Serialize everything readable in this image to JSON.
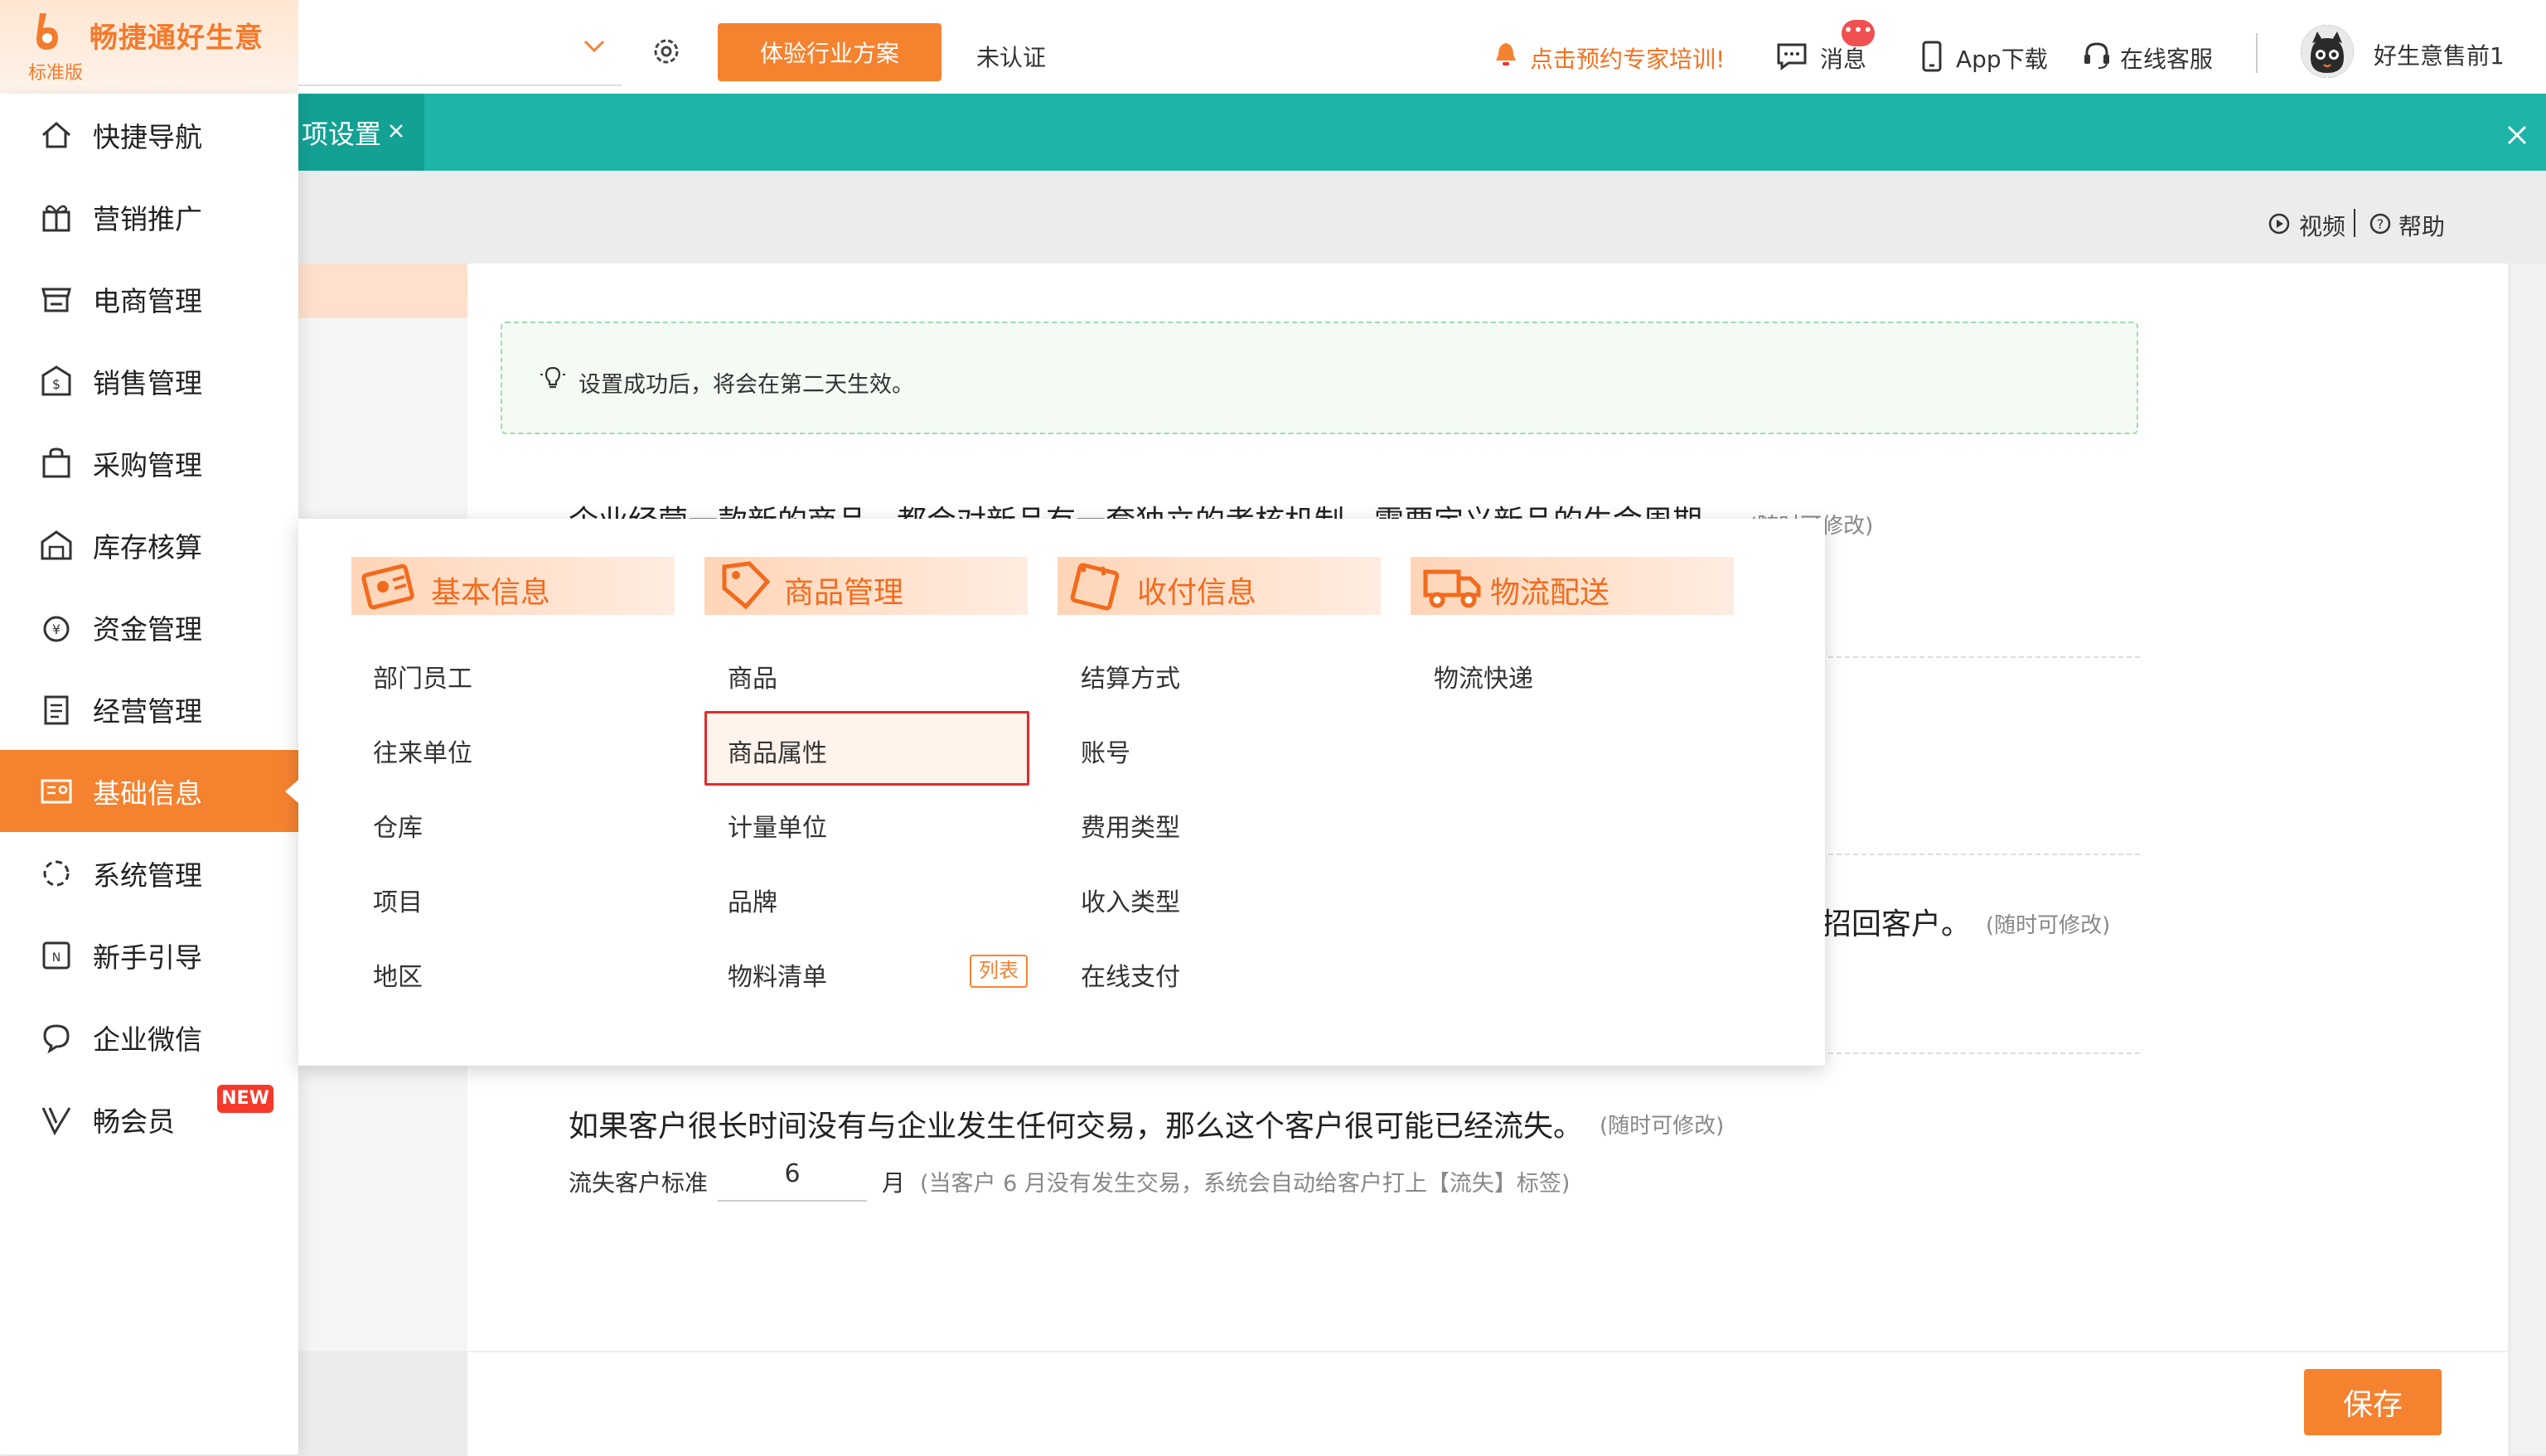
{
  "brand": {
    "title": "畅捷通好生意",
    "edition": "标准版",
    "accent": "#f5822f"
  },
  "header": {
    "trial_button": "体验行业方案",
    "certification": "未认证",
    "training_link": "点击预约专家培训!",
    "message_label": "消息",
    "message_badge": "•••",
    "app_label": "App下载",
    "support_label": "在线客服",
    "user_name": "好生意售前1"
  },
  "tabs": {
    "active_label": "项设置"
  },
  "sidebar": {
    "items": [
      {
        "label": "快捷导航",
        "icon": "home-icon"
      },
      {
        "label": "营销推广",
        "icon": "gift-icon"
      },
      {
        "label": "电商管理",
        "icon": "store-icon"
      },
      {
        "label": "销售管理",
        "icon": "sales-icon"
      },
      {
        "label": "采购管理",
        "icon": "bag-icon"
      },
      {
        "label": "库存核算",
        "icon": "warehouse-icon"
      },
      {
        "label": "资金管理",
        "icon": "money-icon"
      },
      {
        "label": "经营管理",
        "icon": "clipboard-icon"
      },
      {
        "label": "基础信息",
        "icon": "id-card-icon",
        "active": true
      },
      {
        "label": "系统管理",
        "icon": "system-icon"
      },
      {
        "label": "新手引导",
        "icon": "guide-icon"
      },
      {
        "label": "企业微信",
        "icon": "wecom-icon"
      },
      {
        "label": "畅会员",
        "icon": "vip-icon"
      }
    ],
    "new_badge": "NEW"
  },
  "help": {
    "video": "视频",
    "help": "帮助"
  },
  "main": {
    "notice": "设置成功后，将会在第二天生效。",
    "para1": "企业经营一款新的商品，都会对新品有一套独立的考核机制，需要定义新品的生命周期。",
    "para1_hint": "(随时可修改)",
    "para2_tail": "招回客户。",
    "para2_hint": "(随时可修改)",
    "para3": "如果客户很长时间没有与企业发生任何交易，那么这个客户很可能已经流失。",
    "para3_hint": "(随时可修改)",
    "lost_label": "流失客户标准",
    "lost_value": "6",
    "lost_unit": "月",
    "lost_hint": "(当客户 6 月没有发生交易，系统会自动给客户打上【流失】标签)",
    "save_button": "保存"
  },
  "mega_menu": {
    "columns": [
      {
        "title": "基本信息",
        "icon": "basic-info-icon",
        "items": [
          "部门员工",
          "往来单位",
          "仓库",
          "项目",
          "地区"
        ]
      },
      {
        "title": "商品管理",
        "icon": "goods-tag-icon",
        "items": [
          "商品",
          "商品属性",
          "计量单位",
          "品牌",
          "物料清单"
        ]
      },
      {
        "title": "收付信息",
        "icon": "calendar-pay-icon",
        "items": [
          "结算方式",
          "账号",
          "费用类型",
          "收入类型",
          "在线支付"
        ]
      },
      {
        "title": "物流配送",
        "icon": "truck-icon",
        "items": [
          "物流快递"
        ]
      }
    ],
    "list_tag": "列表",
    "highlighted_item": "商品属性"
  }
}
